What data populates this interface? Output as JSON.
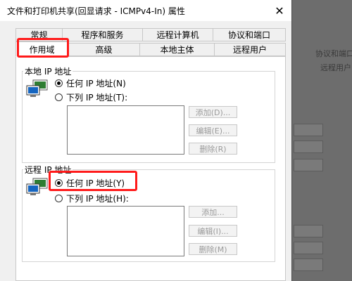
{
  "background": {
    "texts": [
      "协议和端口",
      "远程用户"
    ]
  },
  "dialog": {
    "title": "文件和打印机共享(回显请求 - ICMPv4-In) 属性",
    "close_glyph": "✕"
  },
  "tabs": {
    "row1": [
      "常规",
      "程序和服务",
      "远程计算机",
      "协议和端口"
    ],
    "row2": [
      "作用域",
      "高级",
      "本地主体",
      "远程用户"
    ],
    "active": "作用域"
  },
  "local_ip": {
    "legend": "本地 IP 地址",
    "option_any": "任何 IP 地址(N)",
    "option_list": "下列 IP 地址(T):",
    "selected": "any",
    "buttons": {
      "add": "添加(D)...",
      "edit": "编辑(E)...",
      "remove": "删除(R)"
    }
  },
  "remote_ip": {
    "legend": "远程 IP 地址",
    "option_any": "任何 IP 地址(Y)",
    "option_list": "下列 IP 地址(H):",
    "selected": "any",
    "buttons": {
      "add": "添加...",
      "edit": "编辑(I)...",
      "remove": "删除(M)"
    }
  },
  "colors": {
    "highlight": "#ff1a1a",
    "dialog_bg": "#f0f0f0",
    "panel_bg": "#ffffff",
    "disabled_text": "#9a9a9a"
  }
}
